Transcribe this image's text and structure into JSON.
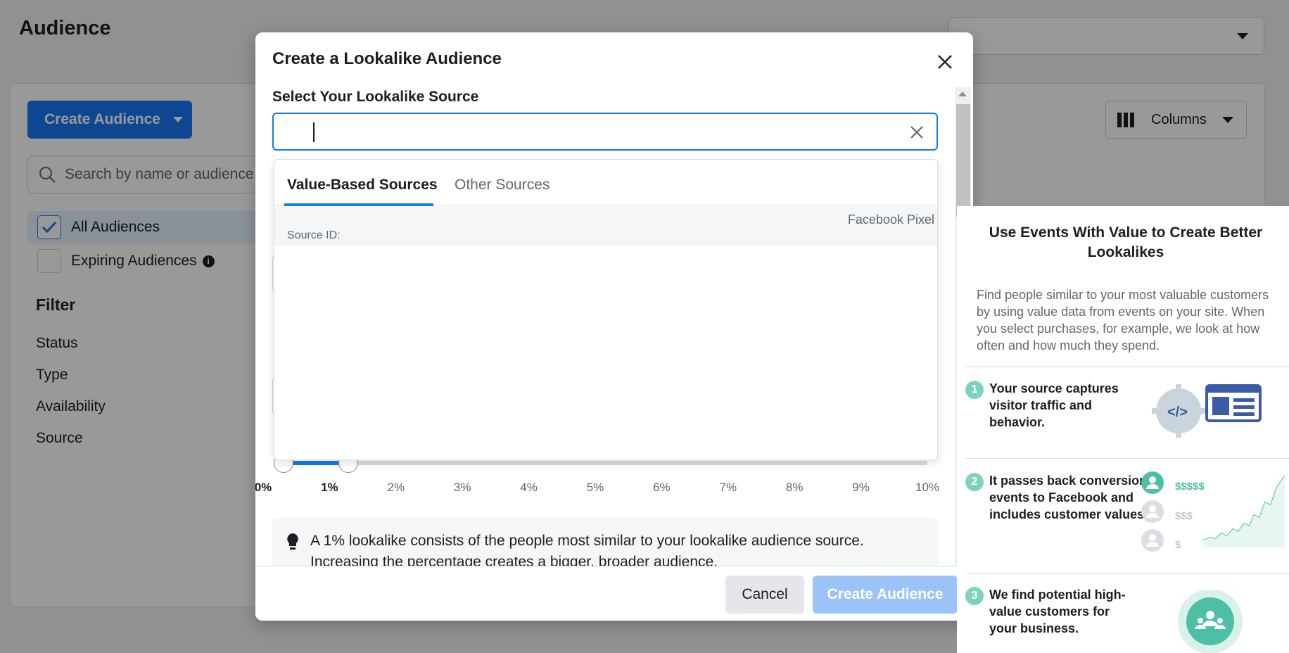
{
  "page": {
    "title": "Audience"
  },
  "sidebar": {
    "create_button": "Create Audience",
    "search_placeholder": "Search by name or audience",
    "items": [
      {
        "label": "All Audiences",
        "checked": true
      },
      {
        "label": "Expiring Audiences",
        "checked": false,
        "info_icon": "info-icon"
      }
    ],
    "filter": {
      "heading": "Filter",
      "items": [
        "Status",
        "Type",
        "Availability",
        "Source"
      ]
    }
  },
  "toolbar": {
    "columns_label": "Columns"
  },
  "modal": {
    "title": "Create a Lookalike Audience",
    "source_label": "Select Your Lookalike Source",
    "source_value": "",
    "tabs": [
      {
        "label": "Value-Based Sources",
        "active": true
      },
      {
        "label": "Other Sources",
        "active": false
      }
    ],
    "source_row": {
      "type": "Facebook Pixel",
      "id_label": "Source ID:"
    },
    "slider": {
      "ticks": [
        "0%",
        "1%",
        "2%",
        "3%",
        "4%",
        "5%",
        "6%",
        "7%",
        "8%",
        "9%",
        "10%"
      ],
      "range_start_percent": 0,
      "range_end_percent": 1
    },
    "tip_text": "A 1% lookalike consists of the people most similar to your lookalike audience source. Increasing the percentage creates a bigger, broader audience.",
    "cancel_label": "Cancel",
    "submit_label": "Create Audience"
  },
  "help_panel": {
    "title": "Use Events With Value to Create Better Lookalikes",
    "description": "Find people similar to your most valuable customers by using value data from events on your site. When you select purchases, for example, we look at how often and how much they spend.",
    "steps": [
      {
        "number": "1",
        "text": "Your source captures visitor traffic and behavior."
      },
      {
        "number": "2",
        "text": "It passes back conversion events to Facebook and includes customer values."
      },
      {
        "number": "3",
        "text": "We find potential high-value customers for your business."
      }
    ],
    "value_tiers": [
      "$$$$$",
      "$$$",
      "$"
    ]
  },
  "colors": {
    "brand": "#1877f2",
    "accent_teal": "#7ed3c0",
    "disabled_button": "#9cc3f7"
  }
}
